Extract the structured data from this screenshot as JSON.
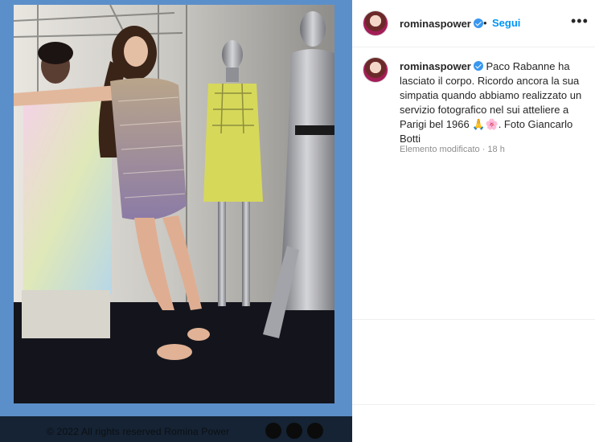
{
  "post": {
    "username": "rominaspower",
    "follow_label": "Segui",
    "separator": "•",
    "more_label": "•••"
  },
  "caption": {
    "username": "rominaspower",
    "text": "Paco Rabanne ha lasciato il corpo. Ricordo ancora la sua simpatia quando abbiamo realizzato un servizio fotografico nel sui atteliere a Parigi bel 1966 🙏🌸. Foto Giancarlo Botti",
    "meta": "Elemento modificato · 18 h"
  },
  "media": {
    "watermark": "© 2022 All rights reserved Romina Power"
  },
  "colors": {
    "accent": "#0095f6",
    "verified": "#3897f0",
    "frame": "#5b8fc9"
  },
  "icons": [
    "verified-badge-icon",
    "more-options-icon"
  ]
}
